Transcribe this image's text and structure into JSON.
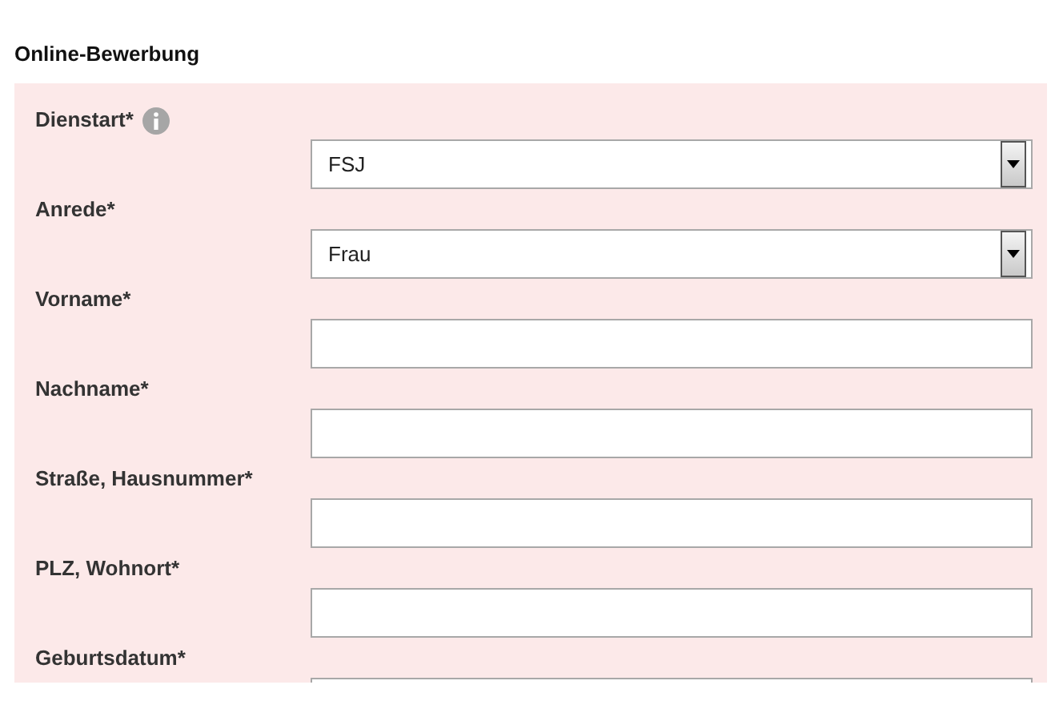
{
  "title": "Online-Bewerbung",
  "fields": [
    {
      "label": "Dienstart*",
      "kind": "select",
      "value": "FSJ",
      "info": true
    },
    {
      "label": "Anrede*",
      "kind": "select",
      "value": "Frau",
      "info": false
    },
    {
      "label": "Vorname*",
      "kind": "text",
      "info": false
    },
    {
      "label": "Nachname*",
      "kind": "text",
      "info": false
    },
    {
      "label": "Straße, Hausnummer*",
      "kind": "text",
      "info": false
    },
    {
      "label": "PLZ, Wohnort*",
      "kind": "text",
      "info": false
    },
    {
      "label": "Geburtsdatum*",
      "kind": "text",
      "info": false
    }
  ]
}
